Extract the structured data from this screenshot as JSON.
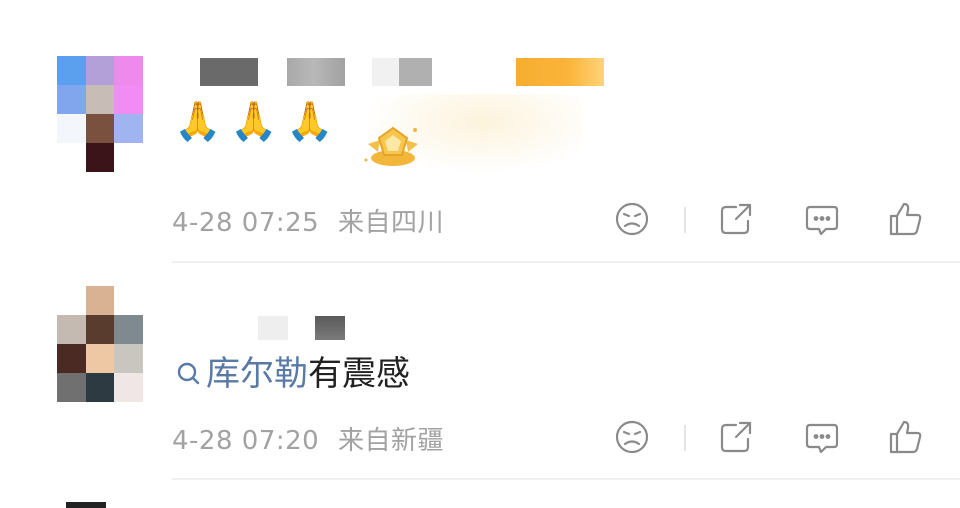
{
  "comments": [
    {
      "emoji": [
        "🙏",
        "🙏",
        "🙏"
      ],
      "badge_icon": "gold-fan-badge-icon",
      "time": "4-28 07:25",
      "location": "来自四川"
    },
    {
      "topic_prefix_icon": "search-icon",
      "topic": "库尔勒",
      "text": "有震感",
      "time": "4-28 07:20",
      "location": "来自新疆"
    }
  ],
  "actions": [
    "dislike-icon",
    "share-icon",
    "comment-icon",
    "like-icon"
  ],
  "colors": {
    "meta": "#a2a2a2",
    "topic": "#5a7aa6",
    "text": "#222222",
    "icon": "#8a8a8a"
  }
}
